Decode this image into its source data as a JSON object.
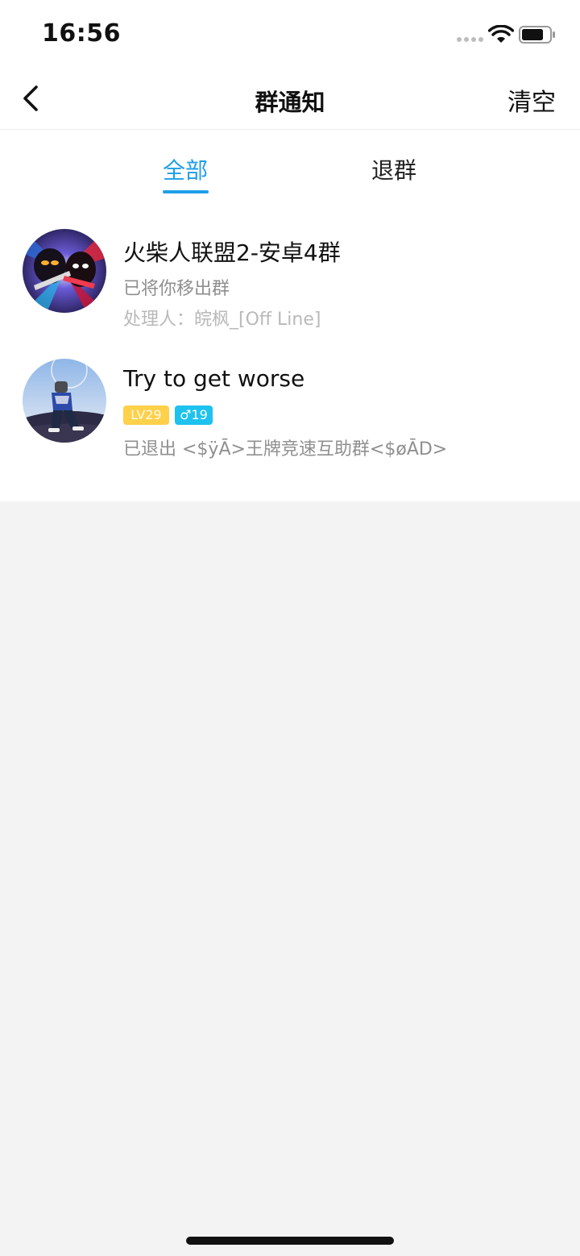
{
  "status_bar": {
    "time": "16:56"
  },
  "nav": {
    "title": "群通知",
    "clear_label": "清空",
    "back_icon": "chevron-left-icon"
  },
  "tabs": [
    {
      "label": "全部",
      "active": true
    },
    {
      "label": "退群",
      "active": false
    }
  ],
  "notifications": [
    {
      "title": "火柴人联盟2-安卓4群",
      "message": "已将你移出群",
      "handler": "处理人：皖枫_[Off Line]"
    },
    {
      "title": "Try to get worse",
      "level": "LV29",
      "gender_age": "♂19",
      "message": "已退出 <$ÿĀ>王牌竞速互助群<$øĀD>"
    }
  ],
  "colors": {
    "accent": "#1e9ee8",
    "level_badge": "#ffd04a",
    "gender_badge": "#1ec2ef",
    "background": "#f3f3f3"
  }
}
